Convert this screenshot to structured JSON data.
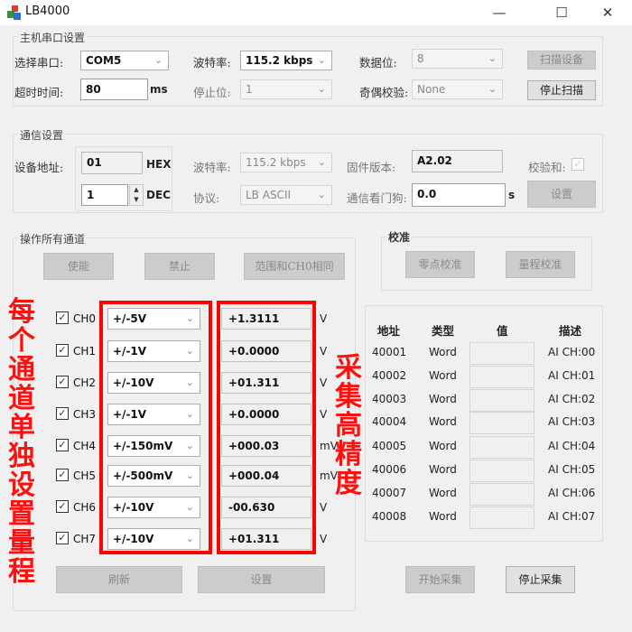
{
  "window": {
    "title": "LB4000",
    "minimize_glyph": "—",
    "maximize_glyph": "☐",
    "close_glyph": "✕"
  },
  "host_serial": {
    "group_label": "主机串口设置",
    "port_label": "选择串口:",
    "port_value": "COM5",
    "baud_label": "波特率:",
    "baud_value": "115.2 kbps",
    "databits_label": "数据位:",
    "databits_value": "8",
    "scan_button": "扫描设备",
    "timeout_label": "超时时间:",
    "timeout_value": "80",
    "timeout_unit": "ms",
    "stopbits_label": "停止位:",
    "stopbits_value": "1",
    "parity_label": "奇偶校验:",
    "parity_value": "None",
    "stop_scan_button": "停止扫描"
  },
  "comm": {
    "group_label": "通信设置",
    "addr_label": "设备地址:",
    "addr_hex_value": "01",
    "hex_unit": "HEX",
    "addr_dec_value": "1",
    "dec_unit": "DEC",
    "baud_label": "波特率:",
    "baud_value": "115.2 kbps",
    "protocol_label": "协议:",
    "protocol_value": "LB ASCII",
    "firmware_label": "固件版本:",
    "firmware_value": "A2.02",
    "watchdog_label": "通信看门狗:",
    "watchdog_value": "0.0",
    "watchdog_unit": "s",
    "checksum_label": "校验和:",
    "checksum_checked": true,
    "set_button": "设置"
  },
  "all_channels": {
    "group_label": "操作所有通道",
    "enable_button": "使能",
    "disable_button": "禁止",
    "same_range_button": "范围和CH0相同",
    "refresh_button": "刷新",
    "set_button": "设置"
  },
  "channels": [
    {
      "name": "CH0",
      "checked": true,
      "range": "+/-5V",
      "value": "+1.3111",
      "unit": "V"
    },
    {
      "name": "CH1",
      "checked": true,
      "range": "+/-1V",
      "value": "+0.0000",
      "unit": "V"
    },
    {
      "name": "CH2",
      "checked": true,
      "range": "+/-10V",
      "value": "+01.311",
      "unit": "V"
    },
    {
      "name": "CH3",
      "checked": true,
      "range": "+/-1V",
      "value": "+0.0000",
      "unit": "V"
    },
    {
      "name": "CH4",
      "checked": true,
      "range": "+/-150mV",
      "value": "+000.03",
      "unit": "mV"
    },
    {
      "name": "CH5",
      "checked": true,
      "range": "+/-500mV",
      "value": "+000.04",
      "unit": "mV"
    },
    {
      "name": "CH6",
      "checked": true,
      "range": "+/-10V",
      "value": "-00.630",
      "unit": "V"
    },
    {
      "name": "CH7",
      "checked": true,
      "range": "+/-10V",
      "value": "+01.311",
      "unit": "V"
    }
  ],
  "calibration": {
    "group_label": "校准",
    "zero_button": "零点校准",
    "span_button": "量程校准"
  },
  "registers": {
    "headers": [
      "地址",
      "类型",
      "值",
      "描述"
    ],
    "rows": [
      {
        "addr": "40001",
        "type": "Word",
        "value": "",
        "desc": "AI CH:00"
      },
      {
        "addr": "40002",
        "type": "Word",
        "value": "",
        "desc": "AI CH:01"
      },
      {
        "addr": "40003",
        "type": "Word",
        "value": "",
        "desc": "AI CH:02"
      },
      {
        "addr": "40004",
        "type": "Word",
        "value": "",
        "desc": "AI CH:03"
      },
      {
        "addr": "40005",
        "type": "Word",
        "value": "",
        "desc": "AI CH:04"
      },
      {
        "addr": "40006",
        "type": "Word",
        "value": "",
        "desc": "AI CH:05"
      },
      {
        "addr": "40007",
        "type": "Word",
        "value": "",
        "desc": "AI CH:06"
      },
      {
        "addr": "40008",
        "type": "Word",
        "value": "",
        "desc": "AI CH:07"
      }
    ],
    "start_button": "开始采集",
    "stop_button": "停止采集"
  },
  "annotations": {
    "left_text": "每个通道单独设置量程",
    "right_text": "采集高精度",
    "color": "#ff0000"
  },
  "glyphs": {
    "chevron": "⌄",
    "check": "✓",
    "spin_up": "▲",
    "spin_down": "▼"
  }
}
